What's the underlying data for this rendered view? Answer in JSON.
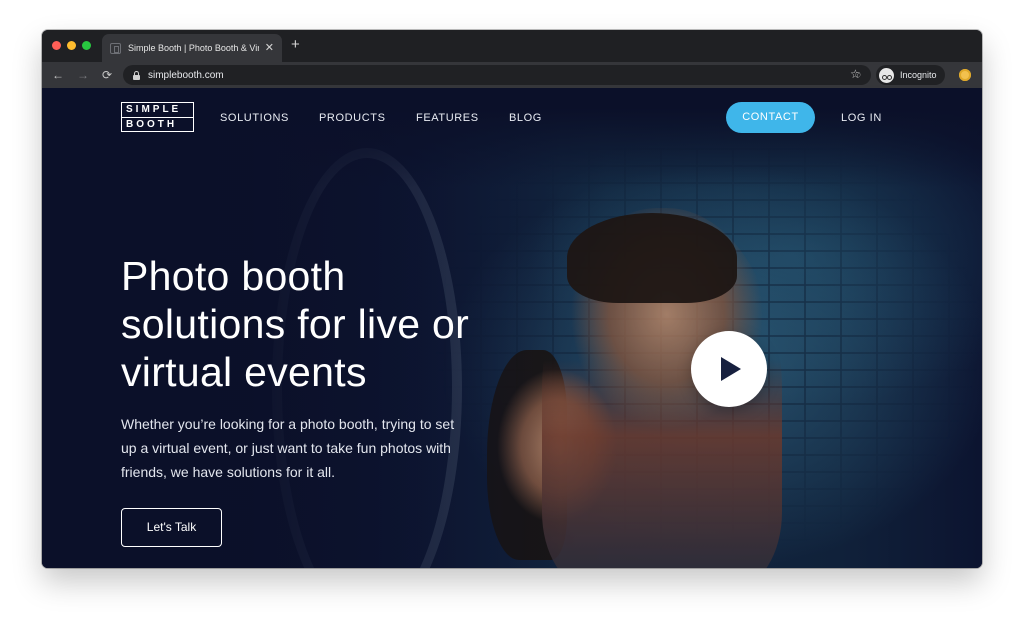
{
  "browser": {
    "tab_title": "Simple Booth | Photo Booth & Virtual Events",
    "url": "simplebooth.com",
    "profile_label": "Incognito",
    "icons": {
      "back": "arrow-left-icon",
      "forward": "arrow-right-icon",
      "reload": "reload-icon",
      "lock": "lock-icon",
      "tracking": "eye-off-icon",
      "bookmark": "star-icon",
      "new_tab": "plus-icon",
      "close_tab": "close-icon"
    },
    "symbols": {
      "back": "←",
      "forward": "→",
      "reload": "⟳",
      "close": "✕",
      "new_tab": "+",
      "star": "☆",
      "eye_off": "◌"
    }
  },
  "site": {
    "logo": {
      "line1": "SIMPLE",
      "line2": "BOOTH"
    },
    "nav": {
      "solutions": "SOLUTIONS",
      "products": "PRODUCTS",
      "features": "FEATURES",
      "blog": "BLOG",
      "contact": "CONTACT",
      "login": "LOG IN"
    },
    "hero": {
      "headline": "Photo booth solutions for live or virtual events",
      "subcopy": "Whether you’re looking for a photo booth, trying to set up a virtual event, or just want to take fun photos with friends, we have solutions for it all.",
      "cta": "Let's Talk"
    },
    "colors": {
      "background": "#0b1029",
      "accent": "#3fb6ea",
      "text": "#ffffff"
    }
  }
}
